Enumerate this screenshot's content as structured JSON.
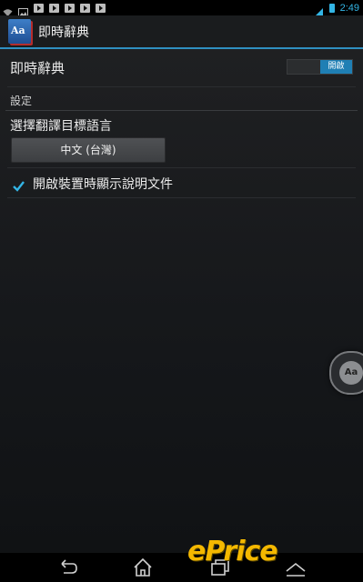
{
  "status_bar": {
    "time": "2:49",
    "icons": [
      "wifi-icon",
      "image-icon",
      "play-icon",
      "play-icon",
      "play-icon",
      "play-icon",
      "play-icon",
      "signal-icon",
      "battery-icon"
    ]
  },
  "action_bar": {
    "title": "即時辭典",
    "app_icon_text": "Aa"
  },
  "settings": {
    "master_label": "即時辭典",
    "master_switch_text": "開啟",
    "section_header": "設定",
    "target_language_title": "選擇翻譯目標語言",
    "target_language_value": "中文 (台灣)",
    "help_doc_label": "開啟裝置時顯示說明文件",
    "help_doc_checked": true
  },
  "floating_button": {
    "label": "Aa"
  },
  "watermark": "ePrice",
  "colors": {
    "accent": "#33b5e5",
    "switch_on": "#1f7fb4",
    "watermark": "#f4b800"
  }
}
